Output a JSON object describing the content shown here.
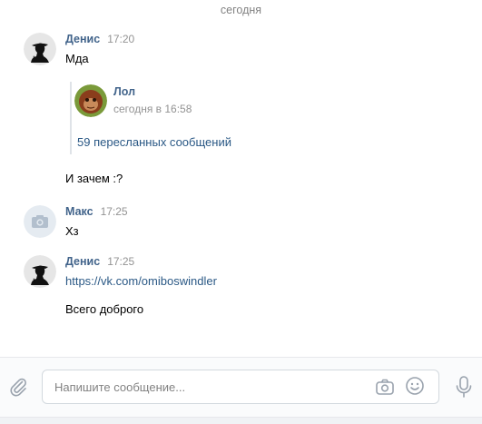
{
  "date_separator": "сегодня",
  "messages": [
    {
      "author": "Денис",
      "time": "17:20",
      "text": "Мда",
      "forwarded": {
        "author": "Лол",
        "time": "сегодня в 16:58",
        "count_label": "59 пересланных сообщений"
      },
      "text_after": "И зачем :?"
    },
    {
      "author": "Макс",
      "time": "17:25",
      "text": "Хз"
    },
    {
      "author": "Денис",
      "time": "17:25",
      "link": "https://vk.com/omiboswindler",
      "text": "Всего доброго"
    }
  ],
  "composer": {
    "placeholder": "Напишите сообщение..."
  },
  "icons": {
    "attach": "paperclip-icon",
    "camera": "camera-icon",
    "emoji": "smile-icon",
    "voice": "microphone-icon"
  },
  "colors": {
    "author": "#42648b",
    "link": "#2a5885",
    "muted": "#939393"
  }
}
